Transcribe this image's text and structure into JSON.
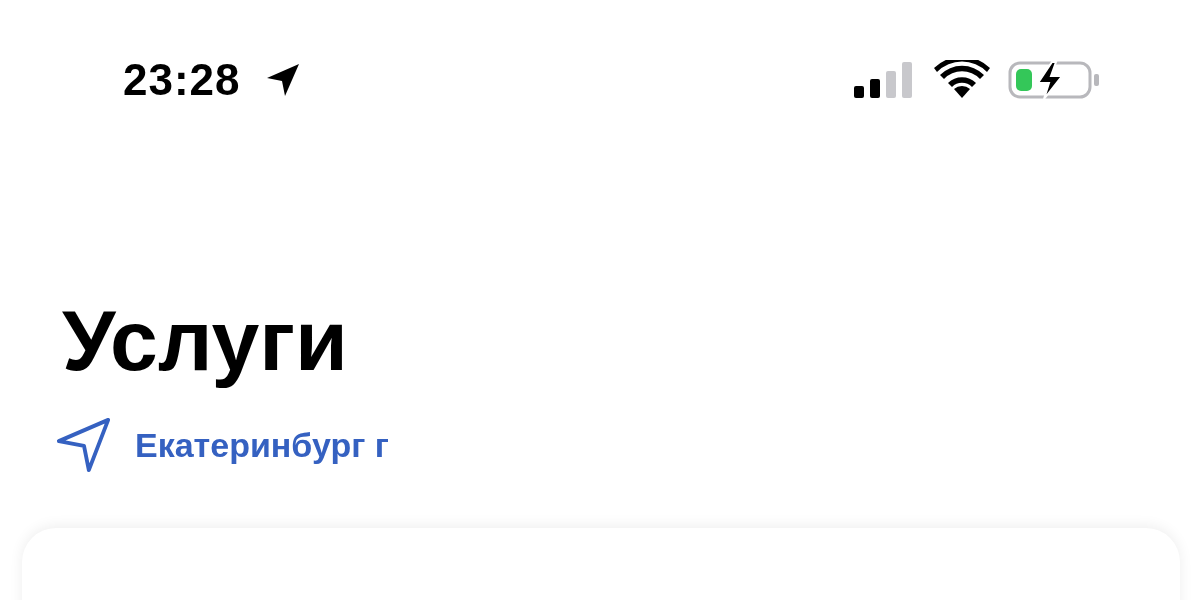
{
  "status_bar": {
    "time": "23:28"
  },
  "title": "Услуги",
  "location": {
    "city": "Екатеринбург г"
  }
}
